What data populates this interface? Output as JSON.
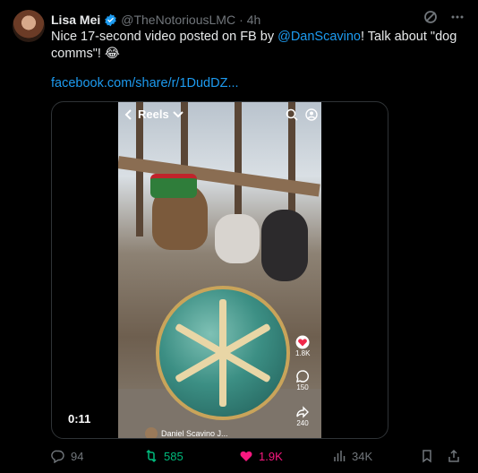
{
  "tweet": {
    "author_name": "Lisa Mei",
    "handle": "@TheNotoriousLMC",
    "separator": "·",
    "time": "4h",
    "text_before": "Nice 17-second video posted on FB by ",
    "mention": "@DanScavino",
    "text_after": "! Talk about \"dog comms\"! 😂",
    "link": "facebook.com/share/r/1DudDZ..."
  },
  "video": {
    "top_label": "Reels",
    "duration": "0:11",
    "author": "Daniel Scavino J...",
    "likes": "1.8K",
    "comments": "150",
    "shares": "240"
  },
  "actions": {
    "replies": "94",
    "reposts": "585",
    "likes": "1.9K",
    "views": "34K"
  },
  "colors": {
    "accent": "#1d9bf0",
    "repost": "#00ba7c",
    "like": "#f91880",
    "muted": "#71767b"
  }
}
